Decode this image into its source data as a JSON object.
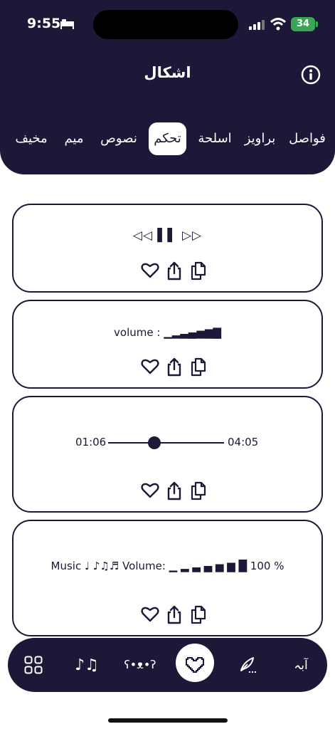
{
  "status_bar": {
    "time": "9:55",
    "battery": "34"
  },
  "header": {
    "title": "اشكال"
  },
  "tabs": [
    {
      "label": "فواصل",
      "active": false
    },
    {
      "label": "براويز",
      "active": false
    },
    {
      "label": "اسلحة",
      "active": false
    },
    {
      "label": "تحكم",
      "active": true
    },
    {
      "label": "نصوص",
      "active": false
    },
    {
      "label": "ميم",
      "active": false
    },
    {
      "label": "مخيف",
      "active": false
    }
  ],
  "cards": [
    {
      "text": "◁◁ ▌▌ ▷▷"
    },
    {
      "text": "volume : ▁▂▃▄▅▆▇"
    },
    {
      "time_start": "01:06",
      "time_end": "04:05",
      "progress": 0.4
    },
    {
      "text": "Music ♩ ♪♫♬ Volume: ▁ ▂ ▃ ▄ ▅ ▆ █ 100 %"
    }
  ],
  "bottom_nav": {
    "items": [
      {
        "icon": "grid-icon"
      },
      {
        "icon": "music-notes-icon",
        "label": "♪♫"
      },
      {
        "icon": "kaomoji-icon",
        "label": "ʕ•ᴥ•ʔ"
      },
      {
        "icon": "heart-pixel-icon",
        "active": true
      },
      {
        "icon": "feather-pen-icon"
      },
      {
        "icon": "arabic-letters-icon",
        "label": "آبہ"
      }
    ]
  },
  "colors": {
    "primary": "#1b1838",
    "battery": "#3aa655",
    "background": "#ffffff"
  }
}
